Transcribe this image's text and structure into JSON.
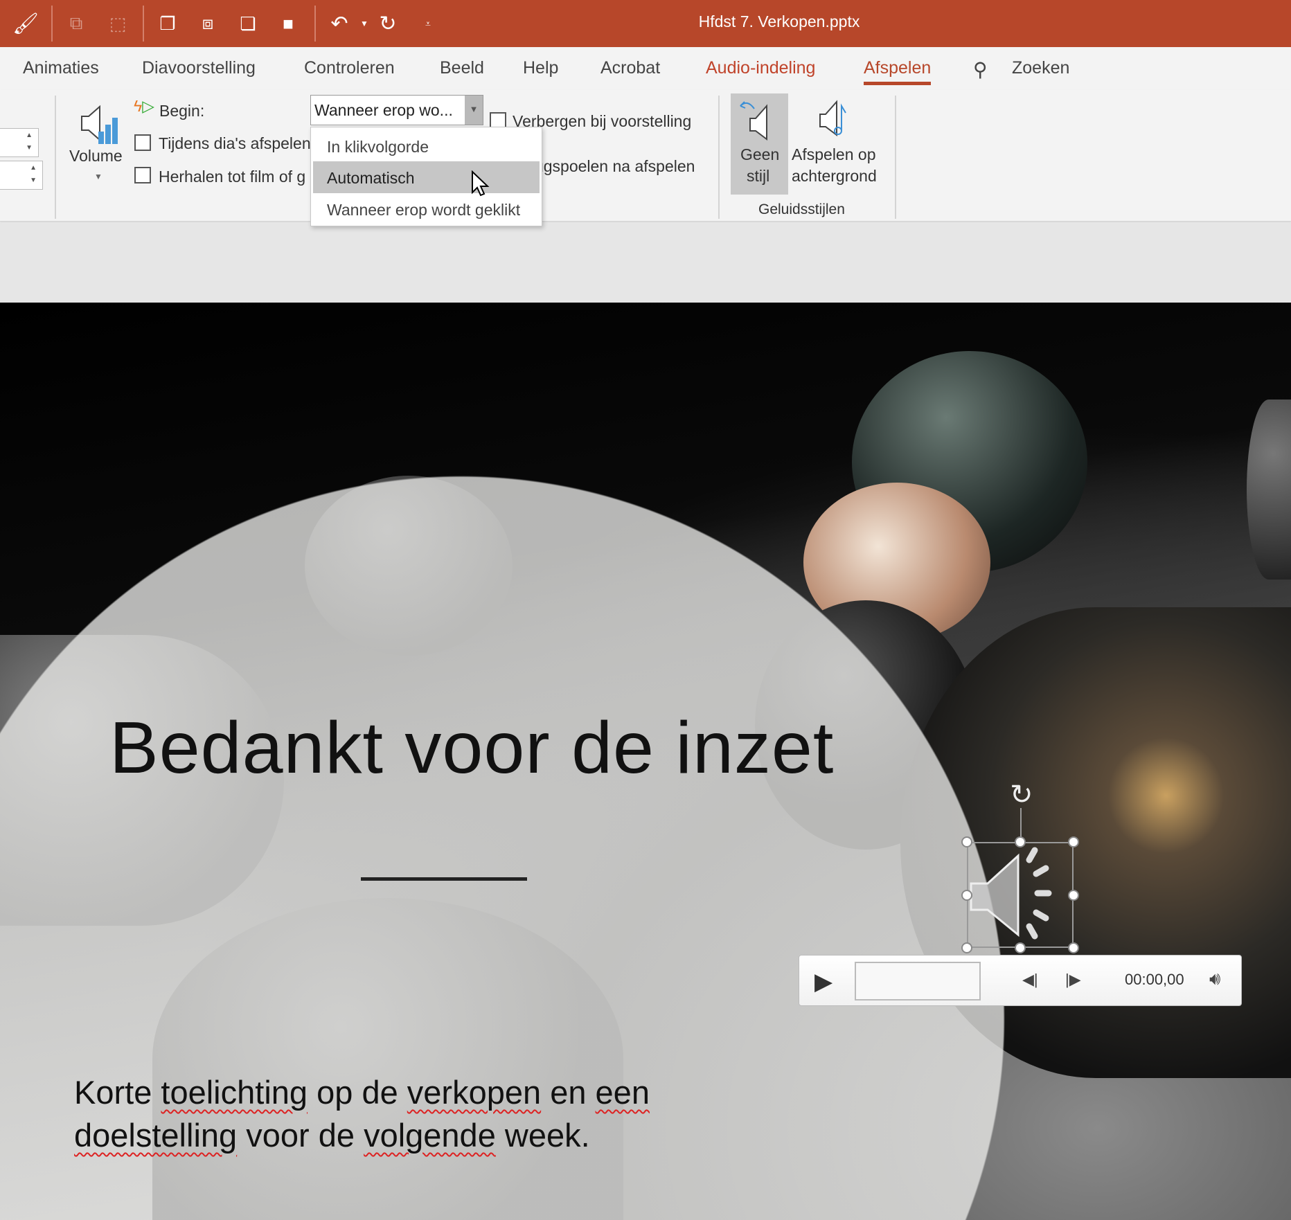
{
  "window": {
    "title": "Hfdst 7. Verkopen.pptx",
    "accent": "#b7472a"
  },
  "quick_access": [
    {
      "icon": "format-painter-icon"
    },
    {
      "icon": "group-icon"
    },
    {
      "icon": "ungroup-icon"
    },
    {
      "icon": "bring-forward-icon"
    },
    {
      "icon": "send-backward-icon"
    },
    {
      "icon": "bring-to-front-icon"
    },
    {
      "icon": "send-to-back-icon"
    },
    {
      "icon": "undo-icon"
    },
    {
      "icon": "redo-icon"
    },
    {
      "icon": "customize-icon"
    }
  ],
  "tabs": [
    {
      "label": "Animaties"
    },
    {
      "label": "Diavoorstelling"
    },
    {
      "label": "Controleren"
    },
    {
      "label": "Beeld"
    },
    {
      "label": "Help"
    },
    {
      "label": "Acrobat"
    },
    {
      "label": "Audio-indeling"
    },
    {
      "label": "Afspelen"
    }
  ],
  "search": {
    "label": "Zoeken"
  },
  "ribbon": {
    "volume": "Volume",
    "begin_label": "Begin:",
    "begin_value": "Wanneer erop wo...",
    "checkboxes": {
      "play_across": "Tijdens dia's afspelen",
      "loop": "Herhalen tot film of g",
      "hide": "Verbergen bij voorstelling",
      "rewind": "Terugspoelen na afspelen"
    },
    "styles": {
      "no_style": "Geen stijl",
      "no_style_2": "stijl",
      "no_style_1": "Geen",
      "bg_1": "Afspelen op",
      "bg_2": "achtergrond",
      "group": "Geluidsstijlen"
    }
  },
  "dropdown": {
    "options": [
      "In klikvolgorde",
      "Automatisch",
      "Wanneer erop wordt geklikt"
    ],
    "highlighted": "Automatisch"
  },
  "slide": {
    "title": "Bedankt voor de inzet",
    "body_words": [
      "Korte ",
      "toelichting",
      " op de ",
      "verkopen",
      " en ",
      "een",
      "doelstelling",
      " voor de ",
      "volgende",
      " week."
    ]
  },
  "player": {
    "time": "00:00,00",
    "progress": 0
  }
}
